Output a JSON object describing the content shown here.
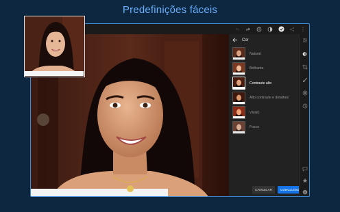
{
  "promo": {
    "title": "Predefinições fáceis"
  },
  "panel": {
    "title": "Cor",
    "presets": [
      {
        "label": "Natural",
        "selected": false
      },
      {
        "label": "Brilhante",
        "selected": false
      },
      {
        "label": "Contraste alto",
        "selected": true
      },
      {
        "label": "Alto contraste e detalhes",
        "selected": false
      },
      {
        "label": "Vívido",
        "selected": false
      },
      {
        "label": "Fosco",
        "selected": false
      }
    ],
    "cancel_label": "CANCELAR",
    "done_label": "CONCLUÍDO"
  },
  "toolbar": {
    "icons": [
      "undo-icon",
      "redo-icon",
      "info-icon",
      "contrast-icon",
      "check-circle-icon",
      "share-icon",
      "more-icon"
    ]
  },
  "rail": {
    "icons": [
      "adjust-icon",
      "presets-icon",
      "crop-icon",
      "brush-icon",
      "healing-icon",
      "history-icon",
      "comment-icon",
      "star-icon",
      "info-icon"
    ]
  },
  "colors": {
    "accent": "#1473e6",
    "frame_border": "#3f8ad6",
    "promo_text": "#6ab0ff",
    "background": "#0d2740"
  }
}
